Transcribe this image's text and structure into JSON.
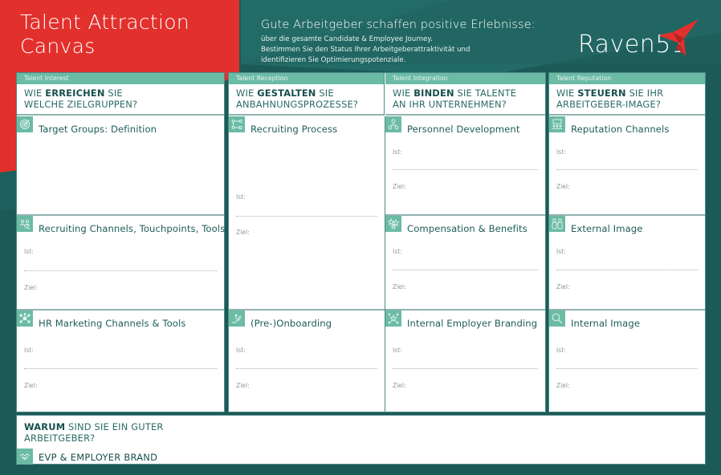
{
  "header": {
    "title_line1": "Talent Attraction",
    "title_line2": "Canvas",
    "intro_heading": "Gute Arbeitgeber schaffen positive Erlebnisse:",
    "intro_lines": [
      "über die gesamte Candidate & Employee Journey.",
      "Bestimmen Sie den Status Ihrer Arbeitgeberattraktivität und",
      "identifizieren Sie Optimierungspotenziale."
    ],
    "logo_text": "Raven51"
  },
  "colors": {
    "red": "#e2302c",
    "teal_dark": "#1c5a58",
    "teal_mid": "#236b67",
    "mint": "#6bbba5",
    "text_teal": "#1e5d5a"
  },
  "columns": [
    {
      "tag": "Talent Interest",
      "q_pre": "WIE ",
      "q_bold": "ERREICHEN",
      "q_post1": " SIE",
      "q_line2": "WELCHE ZIELGRUPPEN?"
    },
    {
      "tag": "Talent Reception",
      "q_pre": "WIE ",
      "q_bold": "GESTALTEN",
      "q_post1": " SIE",
      "q_line2": "ANBAHNUNGSPROZESSE?"
    },
    {
      "tag": "Talent Integration",
      "q_pre": "WIE ",
      "q_bold": "BINDEN",
      "q_post1": " SIE TALENTE",
      "q_line2": "AN IHR UNTERNEHMEN?"
    },
    {
      "tag": "Talent Reputation",
      "q_pre": "WIE ",
      "q_bold": "STEUERN",
      "q_post1": " SIE IHR",
      "q_line2": "ARBEITGEBER-IMAGE?"
    }
  ],
  "cells": {
    "target_groups": {
      "title": "Target Groups: Definition",
      "icon": "target-icon"
    },
    "recruiting_channels": {
      "title": "Recruiting Channels, Touchpoints, Tools",
      "icon": "people-search-icon",
      "ist": "Ist:",
      "ziel": "Ziel:"
    },
    "hr_marketing": {
      "title": "HR Marketing Channels & Tools",
      "icon": "network-icon",
      "ist": "Ist:",
      "ziel": "Ziel:"
    },
    "recruiting_process": {
      "title": "Recruiting Process",
      "icon": "process-flow-icon",
      "ist": "Ist:",
      "ziel": "Ziel:"
    },
    "onboarding": {
      "title": "(Pre-)Onboarding",
      "icon": "escalator-icon",
      "ist": "Ist:",
      "ziel": "Ziel:"
    },
    "personnel_development": {
      "title": "Personnel Development",
      "icon": "org-people-icon",
      "ist": "Ist:",
      "ziel": "Ziel:"
    },
    "compensation": {
      "title": "Compensation & Benefits",
      "icon": "stars-icon",
      "ist": "Ist:",
      "ziel": "Ziel:"
    },
    "internal_branding": {
      "title": "Internal Employer Branding",
      "icon": "team-star-icon",
      "ist": "Ist:",
      "ziel": "Ziel:"
    },
    "reputation_channels": {
      "title": "Reputation Channels",
      "icon": "audience-screen-icon",
      "ist": "Ist:",
      "ziel": "Ziel:"
    },
    "external_image": {
      "title": "External Image",
      "icon": "binoculars-icon",
      "ist": "Ist:",
      "ziel": "Ziel:"
    },
    "internal_image": {
      "title": "Internal Image",
      "icon": "magnifier-icon",
      "ist": "Ist:",
      "ziel": "Ziel:"
    }
  },
  "bottom": {
    "q_bold": "WARUM",
    "q_post1": " SIND SIE EIN GUTER",
    "q_line2": "ARBEITGEBER?",
    "evp_title": "EVP & EMPLOYER BRAND",
    "icon": "handshake-icon"
  }
}
